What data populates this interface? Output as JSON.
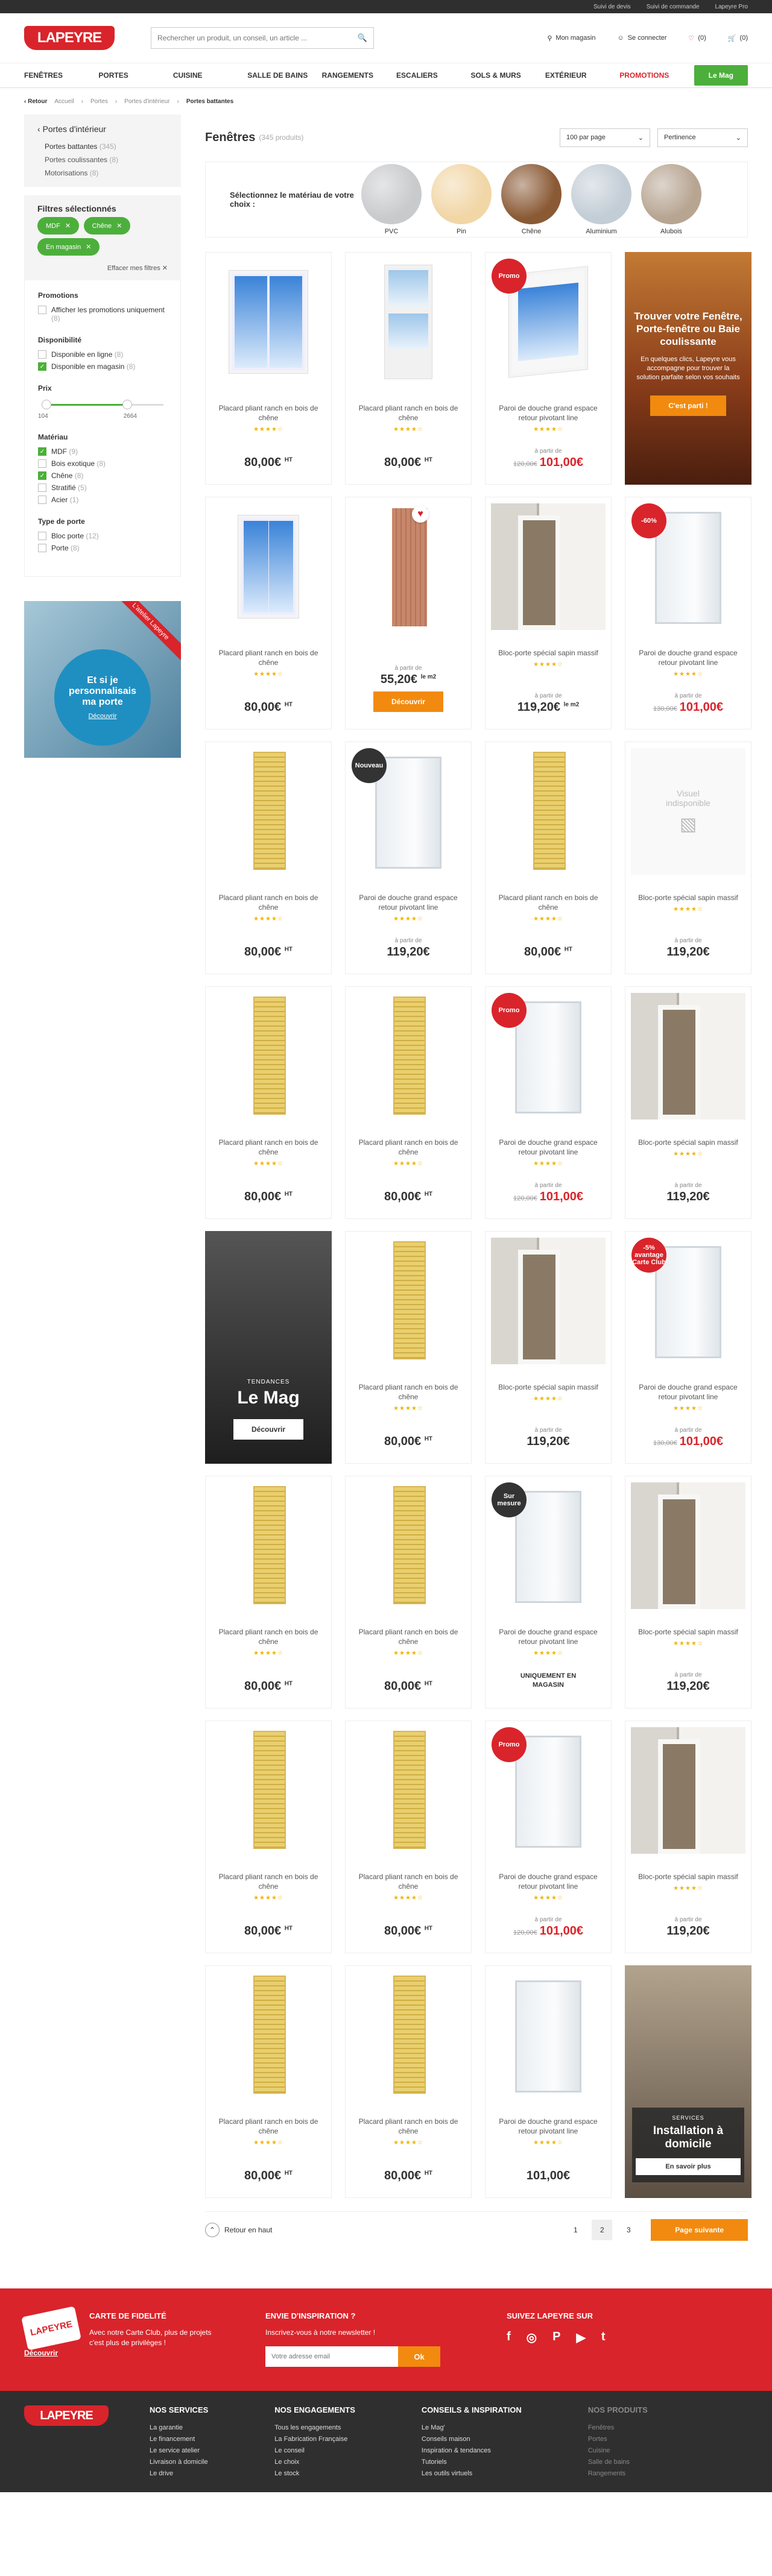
{
  "topbar": {
    "links": [
      "Suivi de devis",
      "Suivi de commande",
      "Lapeyre Pro"
    ]
  },
  "header": {
    "logo": "LAPEYRE",
    "search_placeholder": "Rechercher un produit, un conseil, un article ...",
    "store": "Mon magasin",
    "login": "Se connecter",
    "wishlist_count": "(0)",
    "cart_count": "(0)"
  },
  "nav": {
    "items": [
      "FENÊTRES",
      "PORTES",
      "CUISINE",
      "SALLE DE BAINS",
      "RANGEMENTS",
      "ESCALIERS",
      "SOLS & MURS",
      "EXTÉRIEUR"
    ],
    "promo": "PROMOTIONS",
    "mag": "Le Mag"
  },
  "breadcrumb": {
    "back": "Retour",
    "items": [
      "Accueil",
      "Portes",
      "Portes d'intérieur"
    ],
    "current": "Portes battantes"
  },
  "sidebar": {
    "title": "Portes d'intérieur",
    "categories": [
      {
        "label": "Portes battantes",
        "count": "(345)"
      },
      {
        "label": "Portes coulissantes",
        "count": "(8)"
      },
      {
        "label": "Motorisations",
        "count": "(8)"
      }
    ],
    "selected_title": "Filtres sélectionnés",
    "chips": [
      "MDF",
      "Chêne",
      "En magasin"
    ],
    "reset": "Effacer mes filtres",
    "facets": {
      "promotions": {
        "title": "Promotions",
        "options": [
          {
            "label": "Afficher les promotions uniquement",
            "count": "(8)",
            "checked": false
          }
        ]
      },
      "availability": {
        "title": "Disponibilité",
        "options": [
          {
            "label": "Disponible en ligne",
            "count": "(8)",
            "checked": false
          },
          {
            "label": "Disponible en magasin",
            "count": "(8)",
            "checked": true
          }
        ]
      },
      "price": {
        "title": "Prix",
        "min": "104",
        "max": "2664"
      },
      "material": {
        "title": "Matériau",
        "options": [
          {
            "label": "MDF",
            "count": "(9)",
            "checked": true
          },
          {
            "label": "Bois exotique",
            "count": "(8)",
            "checked": false
          },
          {
            "label": "Chêne",
            "count": "(8)",
            "checked": true
          },
          {
            "label": "Stratifié",
            "count": "(5)",
            "checked": false
          },
          {
            "label": "Acier",
            "count": "(1)",
            "checked": false
          }
        ]
      },
      "door_type": {
        "title": "Type de porte",
        "options": [
          {
            "label": "Bloc porte",
            "count": "(12)",
            "checked": false
          },
          {
            "label": "Porte",
            "count": "(8)",
            "checked": false
          }
        ]
      }
    },
    "promo": {
      "text": "Et si je personnalisais ma porte",
      "link": "Découvrir",
      "band": "L'atelier Lapeyre"
    }
  },
  "main": {
    "title": "Fenêtres",
    "count": "(345 produits)",
    "per_page": "100 par page",
    "sort": "Pertinence",
    "material_prompt": "Sélectionnez le matériau de votre choix :",
    "materials": [
      {
        "label": "PVC",
        "color": "#c9cacc"
      },
      {
        "label": "Pin",
        "color": "#f1d6a6"
      },
      {
        "label": "Chêne",
        "color": "#8a5a35"
      },
      {
        "label": "Aluminium",
        "color": "#c3cdd6"
      },
      {
        "label": "Alubois",
        "color": "#b7a592"
      }
    ],
    "promo_card": {
      "title": "Trouver votre Fenêtre, Porte-fenêtre ou Baie coulissante",
      "text": "En quelques clics, Lapeyre vous accompagne pour trouver la solution parfaite selon vos souhaits",
      "button": "C'est parti !"
    },
    "mag_card": {
      "kicker": "TENDANCES",
      "title": "Le Mag",
      "button": "Découvrir"
    },
    "install_card": {
      "kicker": "SERVICES",
      "title": "Installation à domicile",
      "button": "En savoir plus"
    },
    "labels": {
      "from": "à partir de",
      "ht": "HT",
      "unavailable": "Visuel indisponible",
      "discover": "Découvrir",
      "stars": "★★★★☆"
    },
    "back_top": "Retour en haut",
    "pages": [
      "1",
      "2",
      "3"
    ],
    "next": "Page suivante"
  },
  "products": [
    {
      "name": "Placard pliant ranch en bois de chêne",
      "price": "80,00€",
      "ht": true,
      "img": "win"
    },
    {
      "name": "Placard pliant ranch en bois de chêne",
      "price": "80,00€",
      "ht": true,
      "img": "door"
    },
    {
      "name": "Paroi de douche grand espace retour pivotant line",
      "price": "101,00€",
      "old": "120,00€",
      "from": true,
      "red": true,
      "badge": "Promo",
      "img": "winwhite"
    },
    {
      "promo_card": true
    },
    {
      "name": "Placard pliant ranch en bois de chêne",
      "price": "80,00€",
      "ht": true,
      "img": "winsmall"
    },
    {
      "name": "",
      "price": "55,20€",
      "unit": "le m2",
      "from": true,
      "button": true,
      "heart": true,
      "img": "wood"
    },
    {
      "name": "Bloc-porte spécial sapin massif",
      "price": "119,20€",
      "unit": "le m2",
      "from": true,
      "img": "room"
    },
    {
      "name": "Paroi de douche grand espace retour pivotant line",
      "price": "101,00€",
      "old": "130,00€",
      "from": true,
      "red": true,
      "badge": "-60%",
      "img": "shower"
    },
    {
      "name": "Placard pliant ranch en bois de chêne",
      "price": "80,00€",
      "ht": true,
      "img": "ranch"
    },
    {
      "name": "Paroi de douche grand espace retour pivotant line",
      "price": "119,20€",
      "from": true,
      "badge": "Nouveau",
      "badgeDark": true,
      "img": "shower"
    },
    {
      "name": "Placard pliant ranch en bois de chêne",
      "price": "80,00€",
      "ht": true,
      "img": "ranch"
    },
    {
      "name": "Bloc-porte spécial sapin massif",
      "price": "119,20€",
      "from": true,
      "img": "none"
    },
    {
      "name": "Placard pliant ranch en bois de chêne",
      "price": "80,00€",
      "ht": true,
      "img": "ranch"
    },
    {
      "name": "Placard pliant ranch en bois de chêne",
      "price": "80,00€",
      "ht": true,
      "img": "ranch"
    },
    {
      "name": "Paroi de douche grand espace retour pivotant line",
      "price": "101,00€",
      "old": "120,00€",
      "from": true,
      "red": true,
      "badge": "Promo",
      "img": "shower"
    },
    {
      "name": "Bloc-porte spécial sapin massif",
      "price": "119,20€",
      "from": true,
      "img": "room"
    },
    {
      "mag_card": true
    },
    {
      "name": "Placard pliant ranch en bois de chêne",
      "price": "80,00€",
      "ht": true,
      "img": "ranch"
    },
    {
      "name": "Bloc-porte spécial sapin massif",
      "price": "119,20€",
      "from": true,
      "img": "room"
    },
    {
      "name": "Paroi de douche grand espace retour pivotant line",
      "price": "101,00€",
      "old": "130,00€",
      "from": true,
      "red": true,
      "badge": "-5% avantage Carte Club",
      "img": "shower"
    },
    {
      "name": "Placard pliant ranch en bois de chêne",
      "price": "80,00€",
      "ht": true,
      "img": "ranch"
    },
    {
      "name": "Placard pliant ranch en bois de chêne",
      "price": "80,00€",
      "ht": true,
      "img": "ranch"
    },
    {
      "name": "Paroi de douche grand espace retour pivotant line",
      "note": "UNIQUEMENT EN MAGASIN",
      "badge": "Sur mesure",
      "badgeDark": true,
      "img": "shower"
    },
    {
      "name": "Bloc-porte spécial sapin massif",
      "price": "119,20€",
      "from": true,
      "img": "room"
    },
    {
      "name": "Placard pliant ranch en bois de chêne",
      "price": "80,00€",
      "ht": true,
      "img": "ranch"
    },
    {
      "name": "Placard pliant ranch en bois de chêne",
      "price": "80,00€",
      "ht": true,
      "img": "ranch"
    },
    {
      "name": "Paroi de douche grand espace retour pivotant line",
      "price": "101,00€",
      "old": "120,00€",
      "from": true,
      "red": true,
      "badge": "Promo",
      "img": "shower"
    },
    {
      "name": "Bloc-porte spécial sapin massif",
      "price": "119,20€",
      "from": true,
      "img": "room"
    },
    {
      "name": "Placard pliant ranch en bois de chêne",
      "price": "80,00€",
      "ht": true,
      "img": "ranch"
    },
    {
      "name": "Placard pliant ranch en bois de chêne",
      "price": "80,00€",
      "ht": true,
      "img": "ranch"
    },
    {
      "name": "Paroi de douche grand espace retour pivotant line",
      "price": "101,00€",
      "img": "shower"
    },
    {
      "install_card": true
    }
  ],
  "loyalty": {
    "title": "CARTE DE FIDELITÉ",
    "text": "Avec notre Carte Club, plus de projets c'est plus de privilèges !",
    "link": "Découvrir",
    "card": "LAPEYRE"
  },
  "newsletter": {
    "title": "ENVIE D'INSPIRATION ?",
    "text": "Inscrivez-vous à notre newsletter !",
    "placeholder": "Votre adresse email",
    "button": "Ok"
  },
  "social": {
    "title": "SUIVEZ LAPEYRE SUR",
    "icons": [
      "f",
      "◎",
      "P",
      "▶",
      "t"
    ]
  },
  "footer": {
    "logo": "LAPEYRE",
    "cols": [
      {
        "title": "NOS SERVICES",
        "items": [
          "La garantie",
          "Le financement",
          "Le service atelier",
          "Livraison à domicile",
          "Le drive"
        ]
      },
      {
        "title": "NOS ENGAGEMENTS",
        "items": [
          "Tous les engagements",
          "La Fabrication Française",
          "Le conseil",
          "Le choix",
          "Le stock"
        ]
      },
      {
        "title": "CONSEILS & INSPIRATION",
        "items": [
          "Le Mag'",
          "Conseils maison",
          "Inspiration & tendances",
          "Tutoriels",
          "Les outils virtuels"
        ]
      },
      {
        "title": "NOS PRODUITS",
        "items": [
          "Fenêtres",
          "Portes",
          "Cuisine",
          "Salle de bains",
          "Rangements"
        ]
      }
    ]
  }
}
